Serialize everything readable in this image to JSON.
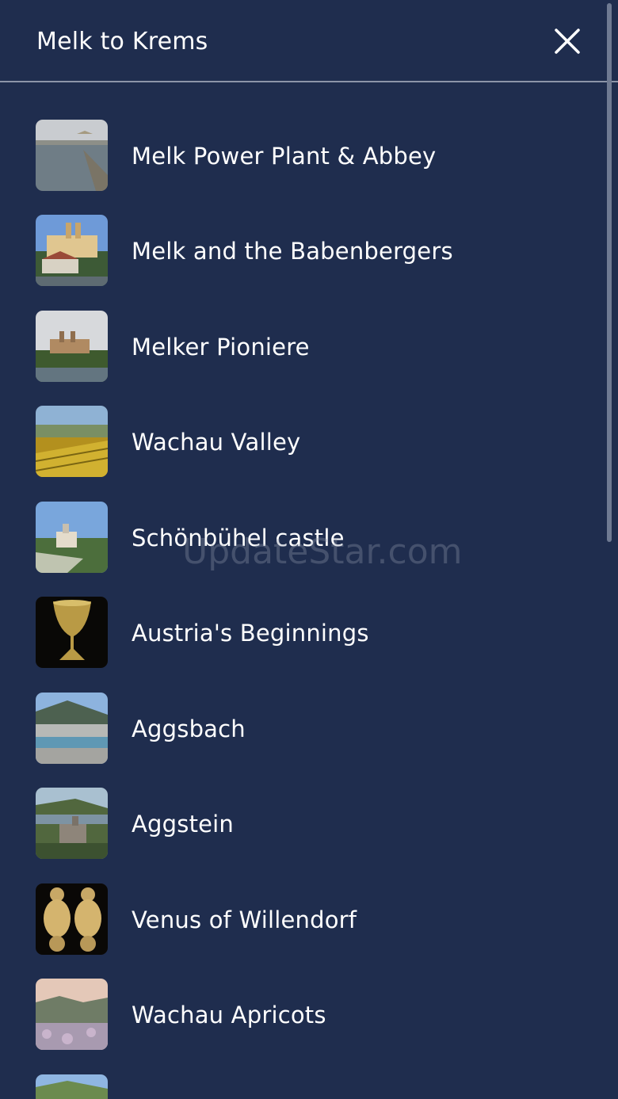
{
  "header": {
    "title": "Melk to Krems"
  },
  "items": [
    {
      "label": "Melk Power Plant & Abbey"
    },
    {
      "label": "Melk and the Babenbergers"
    },
    {
      "label": "Melker Pioniere"
    },
    {
      "label": "Wachau Valley"
    },
    {
      "label": "Schönbühel castle"
    },
    {
      "label": "Austria's Beginnings"
    },
    {
      "label": "Aggsbach"
    },
    {
      "label": "Aggstein"
    },
    {
      "label": "Venus of Willendorf"
    },
    {
      "label": "Wachau Apricots"
    },
    {
      "label": ""
    }
  ],
  "watermark": "UpdateStar.com",
  "colors": {
    "background": "#1f2d4e",
    "divider": "#8c95a8",
    "text": "#ffffff"
  }
}
